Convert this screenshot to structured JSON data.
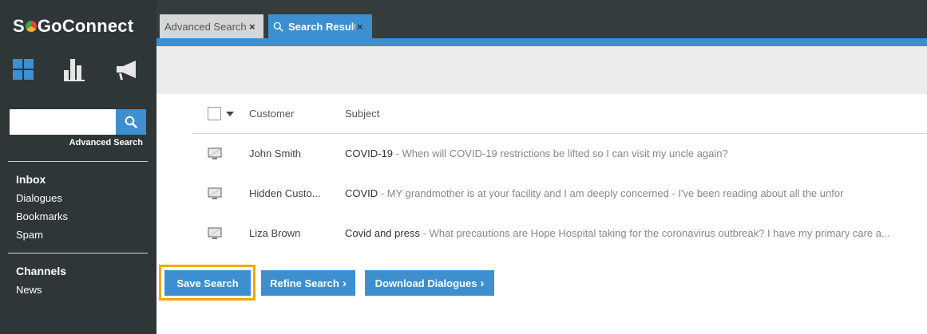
{
  "app": {
    "logo_text_before": "S",
    "logo_text_after": "GoConnect"
  },
  "sidebar": {
    "nav_icons": [
      "dashboard-icon",
      "bar-chart-icon",
      "megaphone-icon"
    ],
    "search": {
      "value": "",
      "placeholder": ""
    },
    "advanced_search_label": "Advanced Search",
    "inbox": {
      "heading": "Inbox",
      "items": [
        "Dialogues",
        "Bookmarks",
        "Spam"
      ]
    },
    "channels": {
      "heading": "Channels",
      "items": [
        "News"
      ]
    }
  },
  "tabs": [
    {
      "label": "Advanced Search",
      "close": "×",
      "active": false
    },
    {
      "label": "Search Results",
      "close": "×",
      "active": true,
      "icon": "search-icon"
    }
  ],
  "table": {
    "headers": {
      "customer": "Customer",
      "subject": "Subject"
    },
    "rows": [
      {
        "customer": "John Smith",
        "subject": "COVID-19",
        "preview": " - When will COVID-19 restrictions be lifted so I can visit my uncle again?"
      },
      {
        "customer": "Hidden Custo...",
        "subject": "COVID",
        "preview": " - MY grandmother is at your facility and I am deeply concerned - I've been reading about all the unfor"
      },
      {
        "customer": "Liza Brown",
        "subject": "Covid and press",
        "preview": " - What precautions are Hope Hospital taking for the coronavirus outbreak? I have my primary care a..."
      }
    ]
  },
  "actions": {
    "save_search": "Save Search",
    "refine_search": "Refine Search",
    "download_dialogues": "Download Dialogues",
    "chevron": "›"
  },
  "colors": {
    "accent": "#3d8fd0",
    "sidebar": "#2f3638",
    "highlight": "#f2a900"
  }
}
